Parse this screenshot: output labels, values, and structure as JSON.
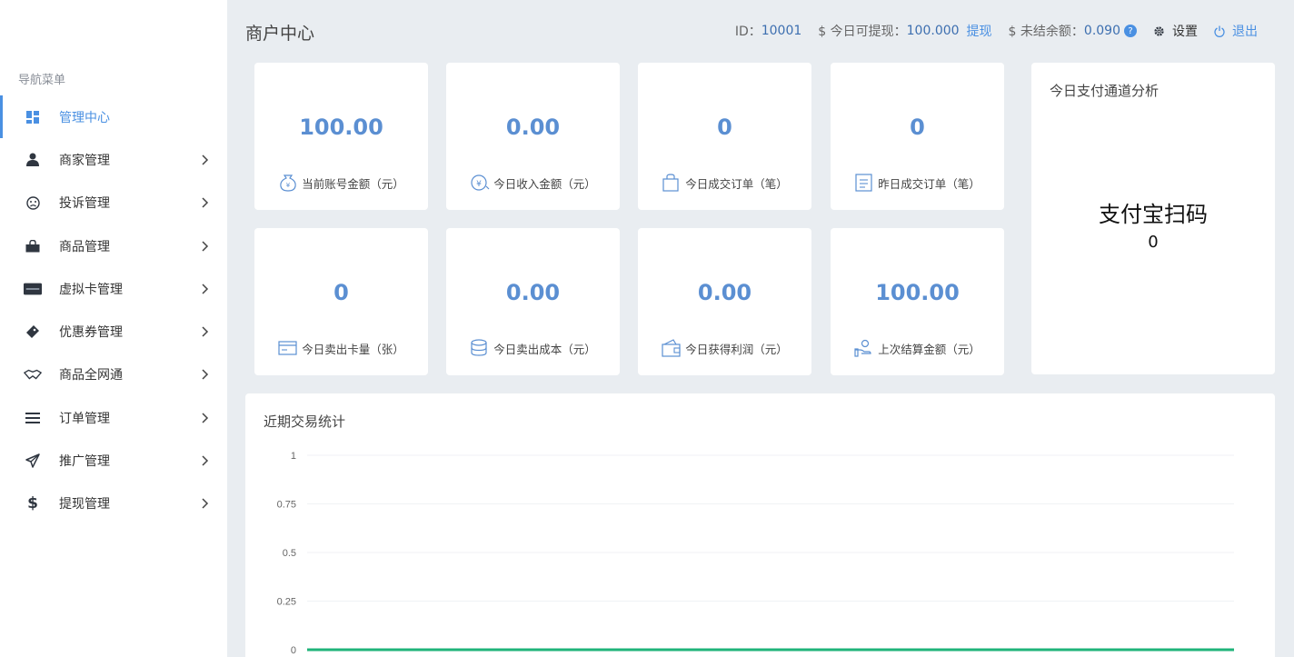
{
  "sidebar": {
    "heading": "导航菜单",
    "items": [
      {
        "label": "管理中心",
        "icon": "dashboard-icon",
        "active": true
      },
      {
        "label": "商家管理",
        "icon": "user-icon"
      },
      {
        "label": "投诉管理",
        "icon": "frown-icon"
      },
      {
        "label": "商品管理",
        "icon": "shopping-bag-icon"
      },
      {
        "label": "虚拟卡管理",
        "icon": "credit-card-icon"
      },
      {
        "label": "优惠券管理",
        "icon": "ticket-icon"
      },
      {
        "label": "商品全网通",
        "icon": "handshake-icon"
      },
      {
        "label": "订单管理",
        "icon": "list-icon"
      },
      {
        "label": "推广管理",
        "icon": "paper-plane-icon"
      },
      {
        "label": "提现管理",
        "icon": "dollar-icon"
      }
    ]
  },
  "header": {
    "title": "商户中心",
    "id_label": "ID：",
    "id_value": "10001",
    "withdrawable_label": "$ 今日可提现：",
    "withdrawable_value": "100.000",
    "withdraw_link": "提现",
    "unsettled_label": "$ 未结余额：",
    "unsettled_value": "0.090",
    "help_glyph": "?",
    "settings_label": "设置",
    "logout_label": "退出"
  },
  "stats": [
    {
      "value": "100.00",
      "label": "当前账号金额（元）",
      "icon": "money-bag-icon"
    },
    {
      "value": "0.00",
      "label": "今日收入金额（元）",
      "icon": "yen-coin-icon"
    },
    {
      "value": "0",
      "label": "今日成交订单（笔）",
      "icon": "shopping-bag-outline-icon"
    },
    {
      "value": "0",
      "label": "昨日成交订单（笔）",
      "icon": "receipt-icon"
    },
    {
      "value": "0",
      "label": "今日卖出卡量（张）",
      "icon": "card-outline-icon"
    },
    {
      "value": "0.00",
      "label": "今日卖出成本（元）",
      "icon": "coins-stack-icon"
    },
    {
      "value": "0.00",
      "label": "今日获得利润（元）",
      "icon": "wallet-icon"
    },
    {
      "value": "100.00",
      "label": "上次结算金额（元）",
      "icon": "hand-coin-icon"
    }
  ],
  "channel_panel": {
    "title": "今日支付通道分析",
    "channel_name": "支付宝扫码",
    "channel_value": "0"
  },
  "trade_chart": {
    "title": "近期交易统计"
  },
  "chart_data": {
    "type": "line",
    "title": "近期交易统计",
    "ylim": [
      0,
      1
    ],
    "yticks": [
      "1",
      "0.75",
      "0.5",
      "0.25",
      "0"
    ],
    "grid": true,
    "series": [
      {
        "color": "#1fb37a",
        "values": [
          0,
          0
        ]
      }
    ]
  }
}
